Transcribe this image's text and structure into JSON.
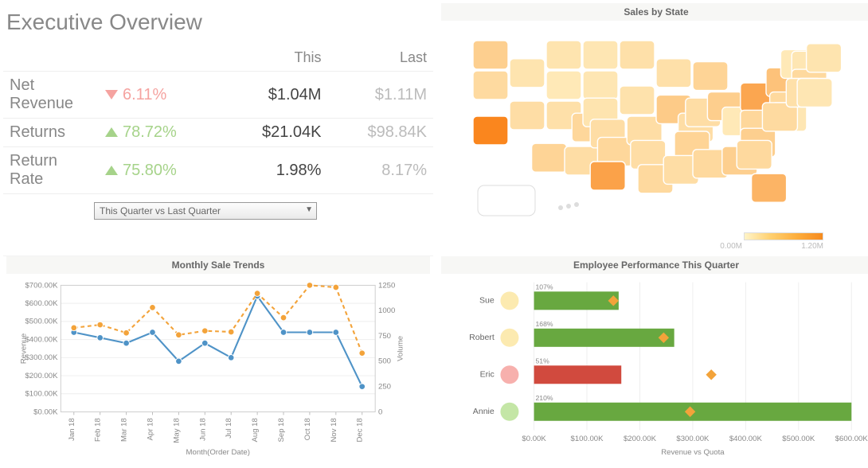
{
  "title": "Executive Overview",
  "kpi": {
    "columns": {
      "this": "This",
      "last": "Last"
    },
    "rows": [
      {
        "label": "Net Revenue",
        "dir": "down",
        "pct": "6.11%",
        "this": "$1.04M",
        "last": "$1.11M"
      },
      {
        "label": "Returns",
        "dir": "up",
        "pct": "78.72%",
        "this": "$21.04K",
        "last": "$98.84K"
      },
      {
        "label": "Return Rate",
        "dir": "up",
        "pct": "75.80%",
        "this": "1.98%",
        "last": "8.17%"
      }
    ],
    "selector": "This Quarter vs Last Quarter"
  },
  "map": {
    "title": "Sales by State",
    "legend_min": "0.00M",
    "legend_max": "1.20M"
  },
  "trends": {
    "title": "Monthly Sale Trends",
    "xlabel": "Month(Order Date)",
    "ylabel_left": "Revenue",
    "ylabel_right": "Volume"
  },
  "employee": {
    "title": "Employee Performance This Quarter",
    "xlabel": "Revenue vs Quota"
  },
  "chart_data": [
    {
      "type": "line",
      "title": "Monthly Sale Trends",
      "xlabel": "Month(Order Date)",
      "categories": [
        "Jan 18",
        "Feb 18",
        "Mar 18",
        "Apr 18",
        "May 18",
        "Jun 18",
        "Jul 18",
        "Aug 18",
        "Sep 18",
        "Oct 18",
        "Nov 18",
        "Dec 18"
      ],
      "series": [
        {
          "name": "Revenue",
          "axis": "left",
          "color": "#4f93c7",
          "values": [
            440,
            410,
            380,
            440,
            280,
            380,
            300,
            640,
            440,
            440,
            440,
            140
          ]
        },
        {
          "name": "Volume",
          "axis": "right",
          "color": "#f3a33a",
          "style": "dashed",
          "values": [
            830,
            860,
            780,
            1030,
            760,
            800,
            790,
            1170,
            930,
            1250,
            1230,
            580
          ]
        }
      ],
      "yleft": {
        "label": "Revenue",
        "ticks": [
          0,
          100,
          200,
          300,
          400,
          500,
          600,
          700
        ],
        "fmt": "$%.2fK"
      },
      "yright": {
        "label": "Volume",
        "ticks": [
          0,
          250,
          500,
          750,
          1000,
          1250
        ]
      }
    },
    {
      "type": "map-choropleth",
      "title": "Sales by State",
      "metric": "Sales (M)",
      "range": [
        0.0,
        1.2
      ],
      "data": {
        "CA": 1.2,
        "TX": 0.9,
        "PA": 0.85,
        "FL": 0.7,
        "NY": 0.55,
        "IL": 0.45,
        "OH": 0.42,
        "GA": 0.4,
        "NC": 0.4,
        "WA": 0.4,
        "AZ": 0.35,
        "TN": 0.35,
        "OK": 0.32,
        "CO": 0.32,
        "MI": 0.35,
        "VA": 0.32,
        "SC": 0.3,
        "AL": 0.3,
        "MS": 0.25,
        "LA": 0.3,
        "AR": 0.25,
        "MO": 0.25,
        "KS": 0.25,
        "IN": 0.25,
        "KY": 0.25,
        "WI": 0.22,
        "MN": 0.22,
        "IA": 0.2,
        "NE": 0.18,
        "SD": 0.15,
        "ND": 0.15,
        "MT": 0.18,
        "ID": 0.18,
        "WY": 0.12,
        "UT": 0.22,
        "NV": 0.25,
        "NM": 0.25,
        "OR": 0.28,
        "ME": 0.18,
        "NH": 0.15,
        "VT": 0.12,
        "MA": 0.3,
        "RI": 0.15,
        "CT": 0.22,
        "NJ": 0.3,
        "DE": 0.15,
        "MD": 0.28,
        "WV": 0.12
      }
    },
    {
      "type": "bar",
      "title": "Employee Performance This Quarter",
      "xlabel": "Revenue vs Quota",
      "xlim": [
        0,
        600
      ],
      "xticks": [
        0,
        100,
        200,
        300,
        400,
        500,
        600
      ],
      "xfmt": "$%.2fK",
      "categories": [
        "Sue",
        "Robert",
        "Eric",
        "Annie"
      ],
      "values": [
        160,
        265,
        165,
        600
      ],
      "quota": [
        150,
        245,
        335,
        295
      ],
      "pct": [
        "107%",
        "168%",
        "51%",
        "210%"
      ],
      "bar_colors": [
        "#68a840",
        "#68a840",
        "#d14a3e",
        "#68a840"
      ],
      "dot_colors": [
        "#fceab0",
        "#fceab0",
        "#f7b0ad",
        "#c4e6a6"
      ]
    }
  ]
}
